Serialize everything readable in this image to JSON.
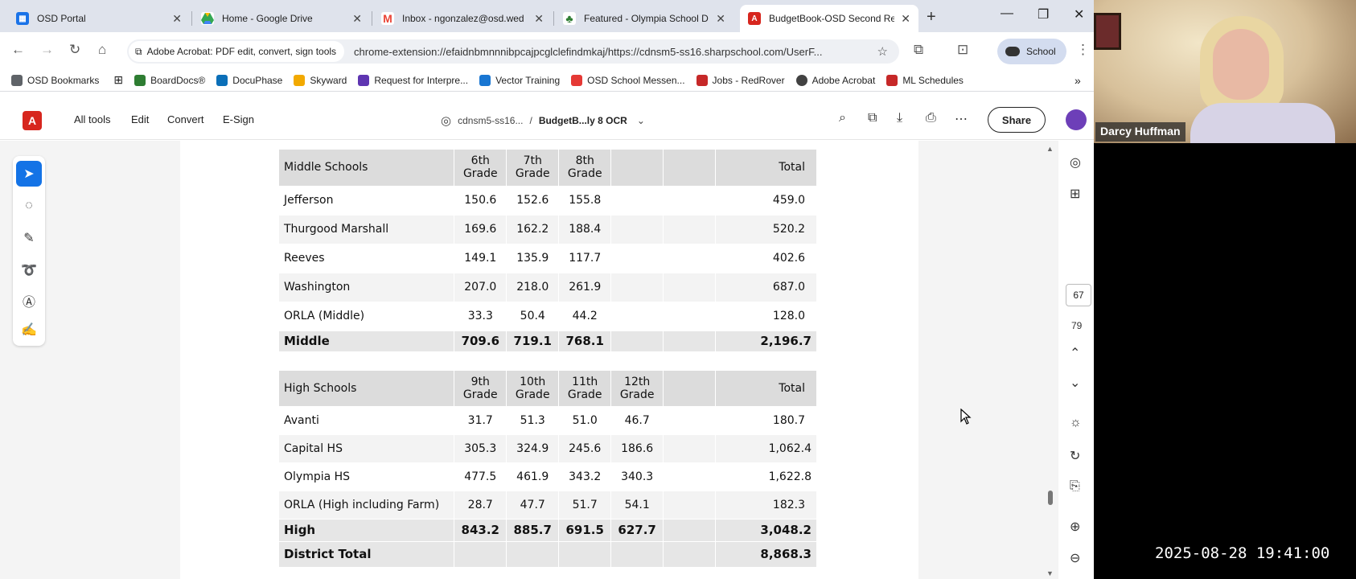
{
  "tabs": [
    {
      "title": "OSD Portal",
      "icon": "portal-icon",
      "color": "#1a73e8",
      "active": false
    },
    {
      "title": "Home - Google Drive",
      "icon": "google-drive-icon",
      "color": "#34a853",
      "active": false
    },
    {
      "title": "Inbox - ngonzalez@osd.wed",
      "icon": "gmail-icon",
      "color": "#ea4335",
      "active": false
    },
    {
      "title": "Featured - Olympia School D",
      "icon": "tree-icon",
      "color": "#2e7d32",
      "active": false
    },
    {
      "title": "BudgetBook-OSD Second Re",
      "icon": "acrobat-icon",
      "color": "#d7261e",
      "active": true
    }
  ],
  "omnibox": {
    "extension_label": "Adobe Acrobat: PDF edit, convert, sign tools",
    "url": "chrome-extension://efaidnbmnnnibpcajpcglclefindmkaj/https://cdnsm5-ss16.sharpschool.com/UserF..."
  },
  "profile": {
    "label": "School"
  },
  "bookmarks": [
    {
      "label": "OSD Bookmarks",
      "color": "#5f6368"
    },
    {
      "label": "BoardDocs®",
      "color": "#2e7d32"
    },
    {
      "label": "DocuPhase",
      "color": "#0b6fb8"
    },
    {
      "label": "Skyward",
      "color": "#f2a900"
    },
    {
      "label": "Request for Interpre...",
      "color": "#5e35b1"
    },
    {
      "label": "Vector Training",
      "color": "#1976d2"
    },
    {
      "label": "OSD School Messen...",
      "color": "#e53935"
    },
    {
      "label": "Jobs - RedRover",
      "color": "#c62828"
    },
    {
      "label": "Adobe Acrobat",
      "color": "#424242"
    },
    {
      "label": "ML Schedules",
      "color": "#c62828"
    }
  ],
  "acrobat": {
    "menu": [
      "All tools",
      "Edit",
      "Convert",
      "E-Sign"
    ],
    "domain": "cdnsm5-ss16...",
    "doc_name": "BudgetB...ly 8 OCR",
    "share_label": "Share",
    "current_page": "67",
    "total_pages": "79"
  },
  "middle_table": {
    "header": [
      "Middle Schools",
      "6th Grade",
      "7th Grade",
      "8th Grade",
      "",
      "",
      "Total"
    ],
    "rows": [
      [
        "Jefferson",
        "150.6",
        "152.6",
        "155.8",
        "",
        "",
        "459.0"
      ],
      [
        "Thurgood Marshall",
        "169.6",
        "162.2",
        "188.4",
        "",
        "",
        "520.2"
      ],
      [
        "Reeves",
        "149.1",
        "135.9",
        "117.7",
        "",
        "",
        "402.6"
      ],
      [
        "Washington",
        "207.0",
        "218.0",
        "261.9",
        "",
        "",
        "687.0"
      ],
      [
        "ORLA (Middle)",
        "33.3",
        "50.4",
        "44.2",
        "",
        "",
        "128.0"
      ]
    ],
    "total": [
      "Middle",
      "709.6",
      "719.1",
      "768.1",
      "",
      "",
      "2,196.7"
    ]
  },
  "high_table": {
    "header": [
      "High Schools",
      "9th Grade",
      "10th Grade",
      "11th Grade",
      "12th Grade",
      "",
      "Total"
    ],
    "rows": [
      [
        "Avanti",
        "31.7",
        "51.3",
        "51.0",
        "46.7",
        "",
        "180.7"
      ],
      [
        "Capital HS",
        "305.3",
        "324.9",
        "245.6",
        "186.6",
        "",
        "1,062.4"
      ],
      [
        "Olympia HS",
        "477.5",
        "461.9",
        "343.2",
        "340.3",
        "",
        "1,622.8"
      ],
      [
        "ORLA (High including Farm)",
        "28.7",
        "47.7",
        "51.7",
        "54.1",
        "",
        "182.3"
      ]
    ],
    "total": [
      "High",
      "843.2",
      "885.7",
      "691.5",
      "627.7",
      "",
      "3,048.2"
    ],
    "district_total": [
      "District Total",
      "",
      "",
      "",
      "",
      "",
      "8,868.3"
    ]
  },
  "video": {
    "participant_name": "Darcy Huffman",
    "timestamp": "2025-08-28  19:41:00"
  }
}
